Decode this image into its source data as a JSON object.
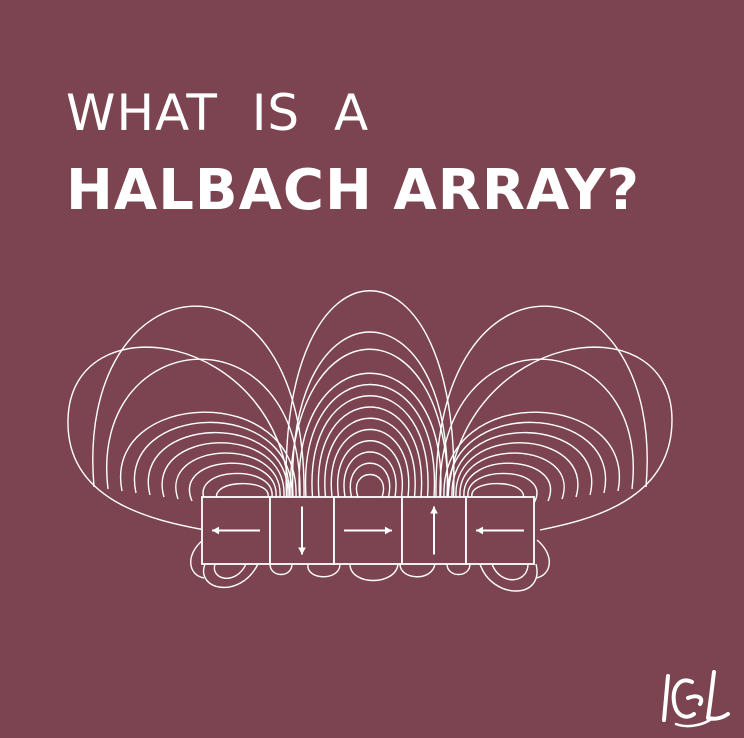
{
  "title": {
    "line1": "WHAT  IS  A",
    "line2": "HALBACH ARRAY?"
  },
  "diagram": {
    "magnet_arrows": [
      "left",
      "down",
      "right",
      "up",
      "left"
    ],
    "color": "#ffffff"
  },
  "logo": {
    "text": "ICL"
  },
  "colors": {
    "background": "#7b4450",
    "foreground": "#ffffff"
  }
}
